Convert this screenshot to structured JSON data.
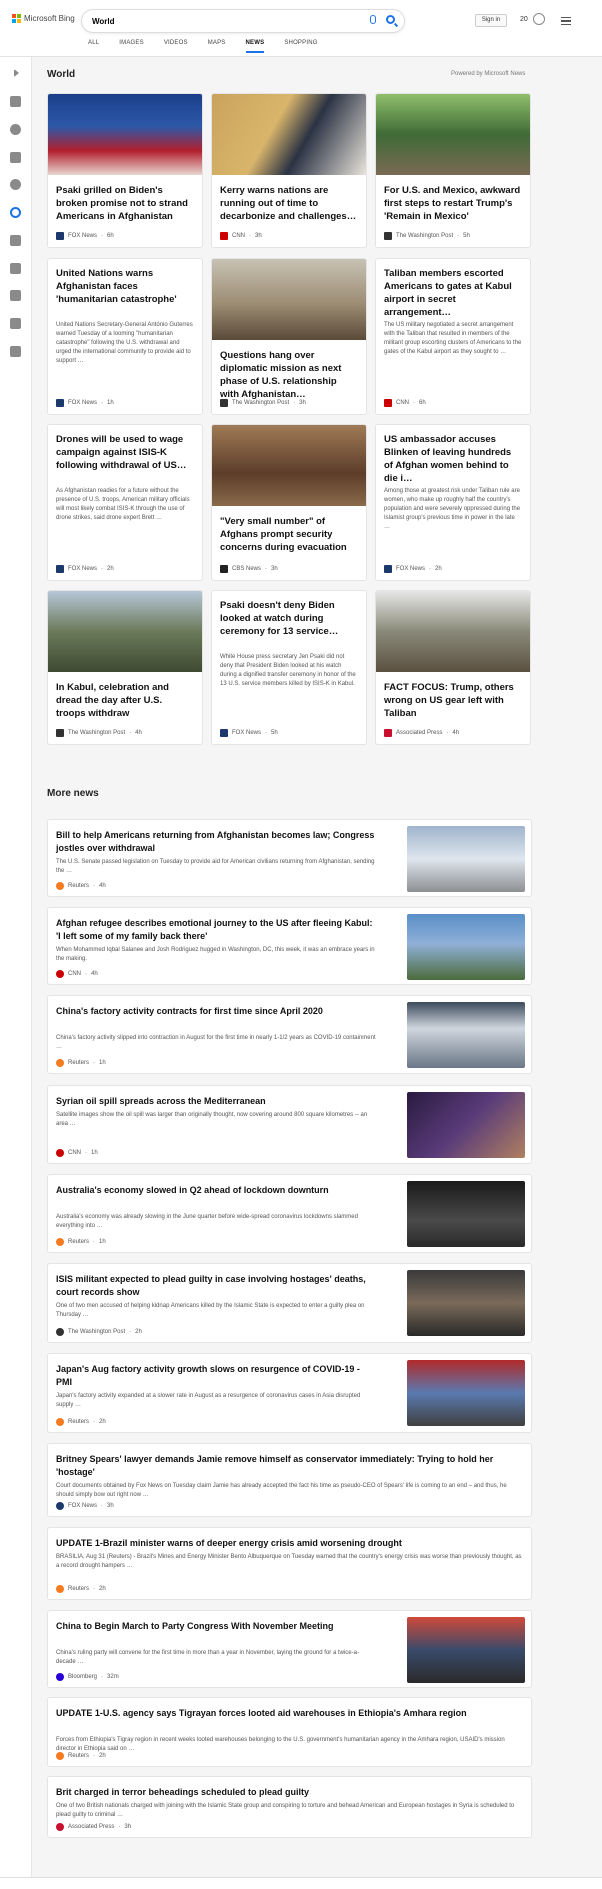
{
  "header": {
    "logo_text": "Microsoft Bing",
    "search_value": "World",
    "signin_label": "Sign in",
    "points": "20"
  },
  "tabs": [
    "ALL",
    "IMAGES",
    "VIDEOS",
    "MAPS",
    "NEWS",
    "SHOPPING"
  ],
  "active_tab": "NEWS",
  "world": {
    "title": "World",
    "powered_by": "Powered by Microsoft News",
    "cards": [
      {
        "title": "Psaki grilled on Biden's broken promise not to strand Americans in Afghanistan",
        "snippet": "",
        "source": "FOX News",
        "time": "6h",
        "logo_color": "#1b3a6b"
      },
      {
        "title": "Kerry warns nations are running out of time to decarbonize and challenges…",
        "snippet": "",
        "source": "CNN",
        "time": "3h",
        "logo_color": "#cc0000"
      },
      {
        "title": "For U.S. and Mexico, awkward first steps to restart Trump's 'Remain in Mexico'",
        "snippet": "",
        "source": "The Washington Post",
        "time": "5h",
        "logo_color": "#333333"
      },
      {
        "title": "United Nations warns Afghanistan faces 'humanitarian catastrophe'",
        "snippet": "United Nations Secretary-General António Guterres warned Tuesday of a looming \"humanitarian catastrophe\" following the U.S. withdrawal and urged the international community to provide aid to support …",
        "source": "FOX News",
        "time": "1h",
        "logo_color": "#1b3a6b"
      },
      {
        "title": "Questions hang over diplomatic mission as next phase of U.S. relationship with Afghanistan…",
        "snippet": "",
        "source": "The Washington Post",
        "time": "3h",
        "logo_color": "#333333"
      },
      {
        "title": "Taliban members escorted Americans to gates at Kabul airport in secret arrangement…",
        "snippet": "The US military negotiated a secret arrangement with the Taliban that resulted in members of the militant group escorting clusters of Americans to the gates of the Kabul airport as they sought to …",
        "source": "CNN",
        "time": "6h",
        "logo_color": "#cc0000"
      },
      {
        "title": "Drones will be used to wage campaign against ISIS-K following withdrawal of US…",
        "snippet": "As Afghanistan readies for a future without the presence of U.S. troops, American military officials will most likely combat ISIS-K through the use of drone strikes, said drone expert Brett …",
        "source": "FOX News",
        "time": "2h",
        "logo_color": "#1b3a6b"
      },
      {
        "title": "\"Very small number\" of Afghans prompt security concerns during evacuation",
        "snippet": "",
        "source": "CBS News",
        "time": "3h",
        "logo_color": "#222222"
      },
      {
        "title": "US ambassador accuses Blinken of leaving hundreds of Afghan women behind to die i…",
        "snippet": "Among those at greatest risk under Taliban rule are women, who make up roughly half the country's population and were severely oppressed during the Islamist group's previous time in power in the late …",
        "source": "FOX News",
        "time": "2h",
        "logo_color": "#1b3a6b"
      },
      {
        "title": "In Kabul, celebration and dread the day after U.S. troops withdraw",
        "snippet": "",
        "source": "The Washington Post",
        "time": "4h",
        "logo_color": "#333333"
      },
      {
        "title": "Psaki doesn't deny Biden looked at watch during ceremony for 13 service…",
        "snippet": "White House press secretary Jen Psaki did not deny that President Biden looked at his watch during a dignified transfer ceremony in honor of the 13 U.S. service members killed by ISIS-K in Kabul.",
        "source": "FOX News",
        "time": "5h",
        "logo_color": "#1b3a6b"
      },
      {
        "title": "FACT FOCUS: Trump, others wrong on US gear left with Taliban",
        "snippet": "",
        "source": "Associated Press",
        "time": "4h",
        "logo_color": "#c8102e"
      }
    ]
  },
  "more_news": {
    "title": "More news",
    "items": [
      {
        "title": "Bill to help Americans returning from Afghanistan becomes law; Congress jostles over withdrawal",
        "snippet": "The U.S. Senate passed legislation on Tuesday to provide aid for American civilians returning from Afghanistan, sending the …",
        "source": "Reuters",
        "time": "4h",
        "logo_color": "#f47c20"
      },
      {
        "title": "Afghan refugee describes emotional journey to the US after fleeing Kabul: 'I left some of my family back there'",
        "snippet": "When Mohammed Iqbal Salanee and Josh Rodriguez hugged in Washington, DC, this week, it was an embrace years in the making.",
        "source": "CNN",
        "time": "4h",
        "logo_color": "#cc0000"
      },
      {
        "title": "China's factory activity contracts for first time since April 2020",
        "snippet": "China's factory activity slipped into contraction in August for the first time in nearly 1-1/2 years as COVID-19 containment …",
        "source": "Reuters",
        "time": "1h",
        "logo_color": "#f47c20"
      },
      {
        "title": "Syrian oil spill spreads across the Mediterranean",
        "snippet": "Satellite images show the oil spill was larger than originally thought, now covering around 800 square kilometres -- an area …",
        "source": "CNN",
        "time": "1h",
        "logo_color": "#cc0000"
      },
      {
        "title": "Australia's economy slowed in Q2 ahead of lockdown downturn",
        "snippet": "Australia's economy was already slowing in the June quarter before wide-spread coronavirus lockdowns slammed everything into …",
        "source": "Reuters",
        "time": "1h",
        "logo_color": "#f47c20"
      },
      {
        "title": "ISIS militant expected to plead guilty in case involving hostages' deaths, court records show",
        "snippet": "One of two men accused of helping kidnap Americans killed by the Islamic State is expected to enter a guilty plea on Thursday …",
        "source": "The Washington Post",
        "time": "2h",
        "logo_color": "#333333"
      },
      {
        "title": "Japan's Aug factory activity growth slows on resurgence of COVID-19 - PMI",
        "snippet": "Japan's factory activity expanded at a slower rate in August as a resurgence of coronavirus cases in Asia disrupted supply …",
        "source": "Reuters",
        "time": "2h",
        "logo_color": "#f47c20"
      },
      {
        "title": "Britney Spears' lawyer demands Jamie remove himself as conservator immediately: Trying to hold her 'hostage'",
        "snippet": "Court documents obtained by Fox News on Tuesday claim Jamie has already accepted the fact his time as pseudo-CEO of Spears' life is coming to an end – and thus, he should simply bow out right now …",
        "source": "FOX News",
        "time": "3h",
        "logo_color": "#1b3a6b"
      },
      {
        "title": "UPDATE 1-Brazil minister warns of deeper energy crisis amid worsening drought",
        "snippet": "BRASILIA, Aug 31 (Reuters) - Brazil's Mines and Energy Minister Bento Albuquerque on Tuesday warned that the country's energy crisis was worse than previously thought, as a record drought hampers …",
        "source": "Reuters",
        "time": "2h",
        "logo_color": "#f47c20"
      },
      {
        "title": "China to Begin March to Party Congress With November Meeting",
        "snippet": "China's ruling party will convene for the first time in more than a year in November, laying the ground for a twice-a-decade …",
        "source": "Bloomberg",
        "time": "32m",
        "logo_color": "#2800d7"
      },
      {
        "title": "UPDATE 1-U.S. agency says Tigrayan forces looted aid warehouses in Ethiopia's Amhara region",
        "snippet": "Forces from Ethiopia's Tigray region in recent weeks looted warehouses belonging to the U.S. government's humanitarian agency in the Amhara region, USAID's mission director in Ethiopia said on …",
        "source": "Reuters",
        "time": "2h",
        "logo_color": "#f47c20"
      },
      {
        "title": "Brit charged in terror beheadings scheduled to plead guilty",
        "snippet": "One of two British nationals charged with joining with the Islamic State group and conspiring to torture and behead American and European hostages in Syria is scheduled to plead guilty to criminal …",
        "source": "Associated Press",
        "time": "3h",
        "logo_color": "#c8102e"
      }
    ]
  }
}
